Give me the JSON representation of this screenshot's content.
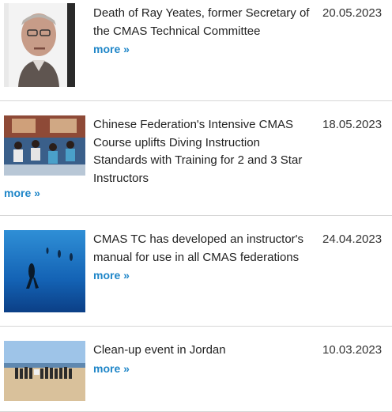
{
  "news": {
    "items": [
      {
        "title": "Death of Ray Yeates, former Secretary of the CMAS Technical Committee",
        "date": "20.05.2023",
        "more_label": "more »",
        "image": "portrait-photo"
      },
      {
        "title": "Chinese Federation's Intensive CMAS Course uplifts Diving Instruction Standards with Training for 2 and 3 Star Instructors",
        "date": "18.05.2023",
        "more_label": "more »",
        "image": "classroom-photo"
      },
      {
        "title": "CMAS TC has developed an instructor's manual for use in all CMAS federations",
        "date": "24.04.2023",
        "more_label": "more »",
        "image": "underwater-divers-photo"
      },
      {
        "title": "Clean-up event in Jordan",
        "date": "10.03.2023",
        "more_label": "more »",
        "image": "beach-group-photo"
      }
    ]
  }
}
